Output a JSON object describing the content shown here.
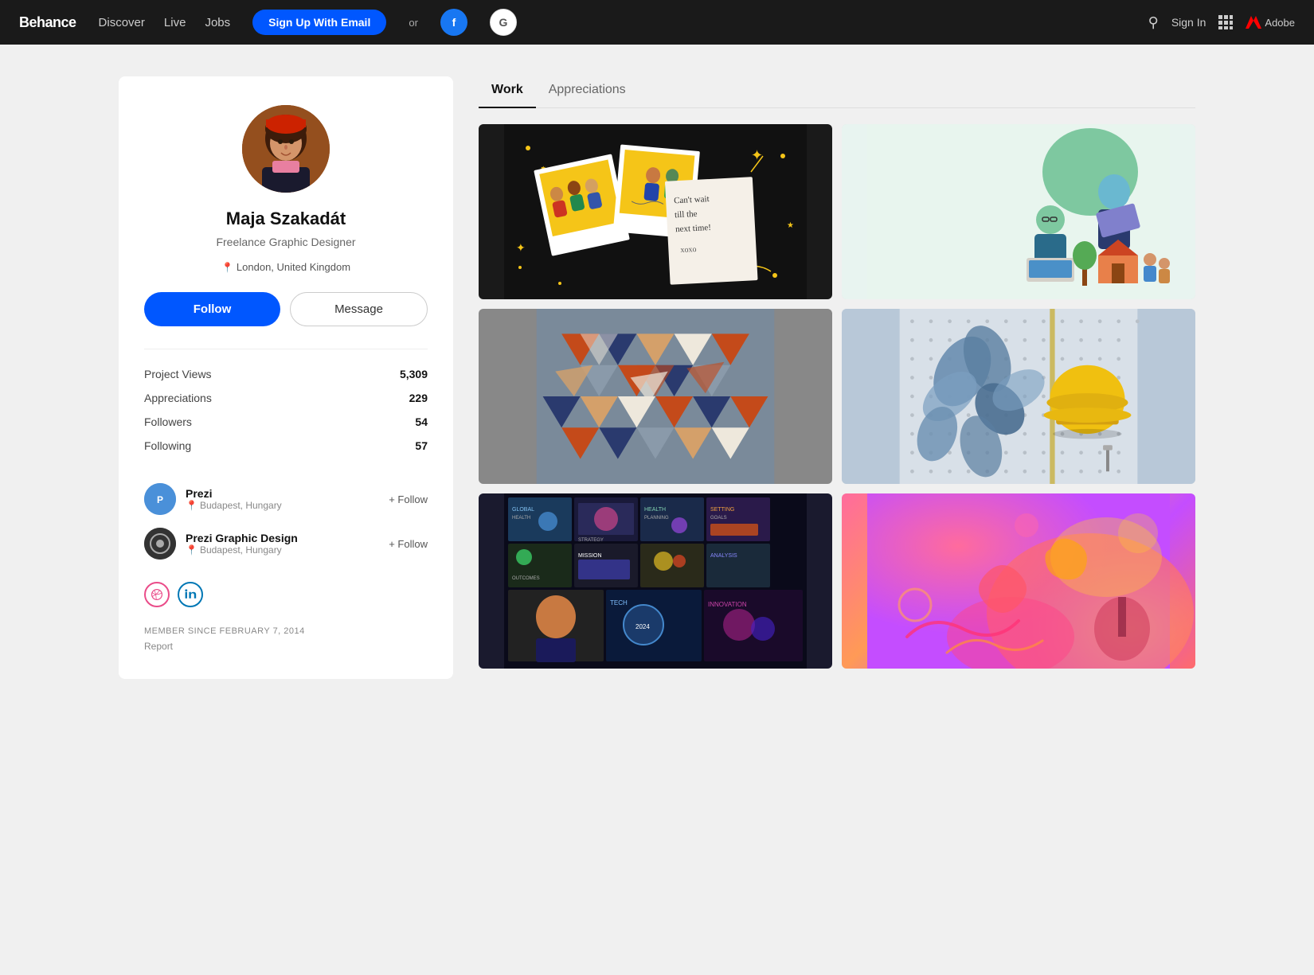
{
  "navbar": {
    "logo": "Behance",
    "links": [
      {
        "label": "Discover",
        "active": false
      },
      {
        "label": "Live",
        "active": false
      },
      {
        "label": "Jobs",
        "active": false
      }
    ],
    "signup_btn": "Sign Up With Email",
    "or_text": "or",
    "facebook_label": "f",
    "google_label": "G",
    "signin_label": "Sign In",
    "adobe_label": "Adobe"
  },
  "profile": {
    "name": "Maja Szakadát",
    "title": "Freelance Graphic Designer",
    "location": "London, United Kingdom",
    "follow_btn": "Follow",
    "message_btn": "Message",
    "stats": [
      {
        "label": "Project Views",
        "value": "5,309"
      },
      {
        "label": "Appreciations",
        "value": "229"
      },
      {
        "label": "Followers",
        "value": "54"
      },
      {
        "label": "Following",
        "value": "57"
      }
    ],
    "orgs": [
      {
        "name": "Prezi",
        "location": "Budapest, Hungary",
        "follow_label": "+ Follow",
        "type": "prezi"
      },
      {
        "name": "Prezi Graphic Design",
        "location": "Budapest, Hungary",
        "follow_label": "+ Follow",
        "type": "prezi-gd"
      }
    ],
    "member_since": "MEMBER SINCE FEBRUARY 7, 2014",
    "report_label": "Report"
  },
  "tabs": [
    {
      "label": "Work",
      "active": true
    },
    {
      "label": "Appreciations",
      "active": false
    }
  ],
  "projects": [
    {
      "id": 1,
      "type": "polaroid-black"
    },
    {
      "id": 2,
      "type": "illustration"
    },
    {
      "id": 3,
      "type": "triangles"
    },
    {
      "id": 4,
      "type": "yellow-helmet"
    },
    {
      "id": 5,
      "type": "presentations"
    },
    {
      "id": 6,
      "type": "colorful-abstract"
    }
  ]
}
